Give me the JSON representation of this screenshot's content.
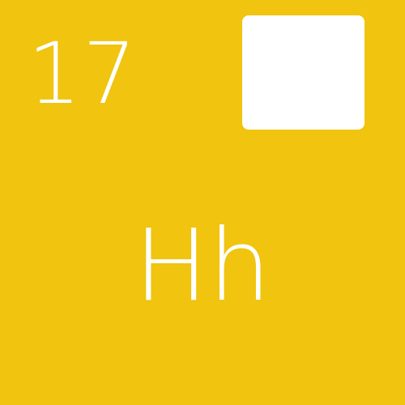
{
  "tile": {
    "number": "17",
    "symbol": "Hh",
    "background_color": "#f0c40f",
    "foreground_color": "#ffffff"
  }
}
